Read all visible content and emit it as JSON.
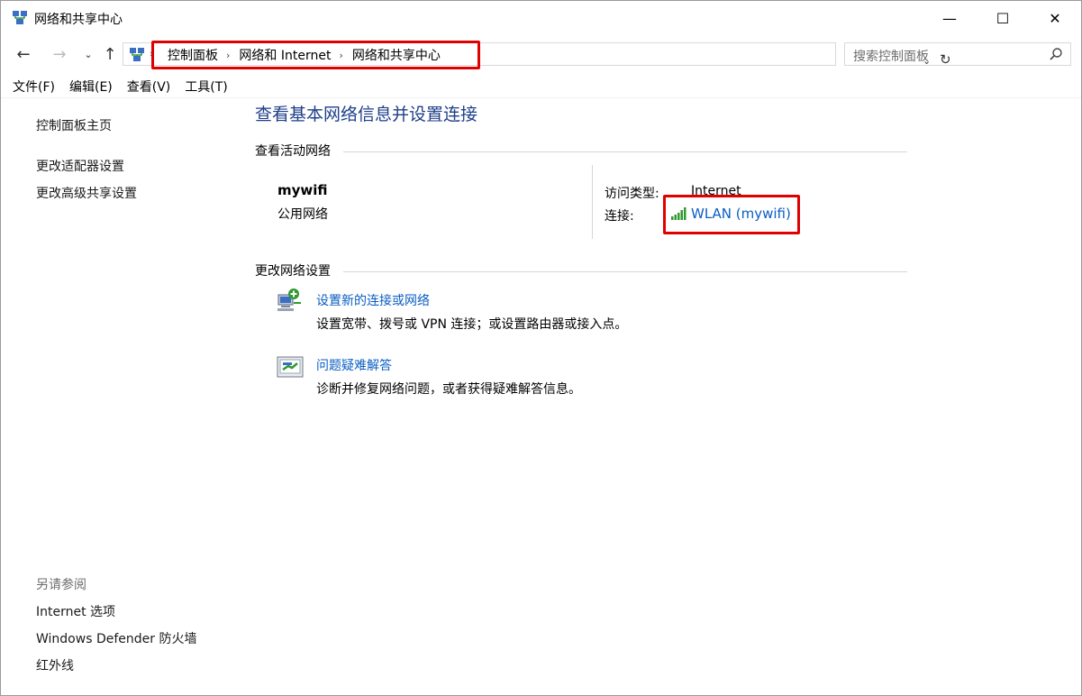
{
  "window": {
    "title": "网络和共享中心",
    "minimize_glyph": "—",
    "maximize_glyph": "☐",
    "close_glyph": "✕"
  },
  "nav": {
    "back_glyph": "←",
    "forward_glyph": "→",
    "recent_glyph": "⌄",
    "up_glyph": "↑",
    "breadcrumbs": [
      "控制面板",
      "网络和 Internet",
      "网络和共享中心"
    ],
    "breadcrumb_sep": "›",
    "dropdown_glyph": "⌄",
    "refresh_glyph": "↻"
  },
  "search": {
    "placeholder": "搜索控制面板"
  },
  "menu": {
    "items": [
      "文件(F)",
      "编辑(E)",
      "查看(V)",
      "工具(T)"
    ]
  },
  "sidebar": {
    "home": "控制面板主页",
    "links": [
      "更改适配器设置",
      "更改高级共享设置"
    ],
    "see_also_title": "另请参阅",
    "see_also": [
      "Internet 选项",
      "Windows Defender 防火墙",
      "红外线"
    ]
  },
  "main": {
    "title": "查看基本网络信息并设置连接",
    "active_networks_heading": "查看活动网络",
    "network": {
      "name": "mywifi",
      "category": "公用网络",
      "access_type_label": "访问类型:",
      "access_type_value": "Internet",
      "connection_label": "连接:",
      "connection_value": "WLAN (mywifi)"
    },
    "change_settings_heading": "更改网络设置",
    "tasks": [
      {
        "link": "设置新的连接或网络",
        "desc": "设置宽带、拨号或 VPN 连接；或设置路由器或接入点。",
        "icon": "new-connection-icon"
      },
      {
        "link": "问题疑难解答",
        "desc": "诊断并修复网络问题，或者获得疑难解答信息。",
        "icon": "troubleshoot-icon"
      }
    ]
  },
  "colors": {
    "title_blue": "#1e3f8a",
    "link_blue": "#0a5ec2",
    "highlight_red": "#e00000",
    "signal_green": "#2f9a2f"
  }
}
